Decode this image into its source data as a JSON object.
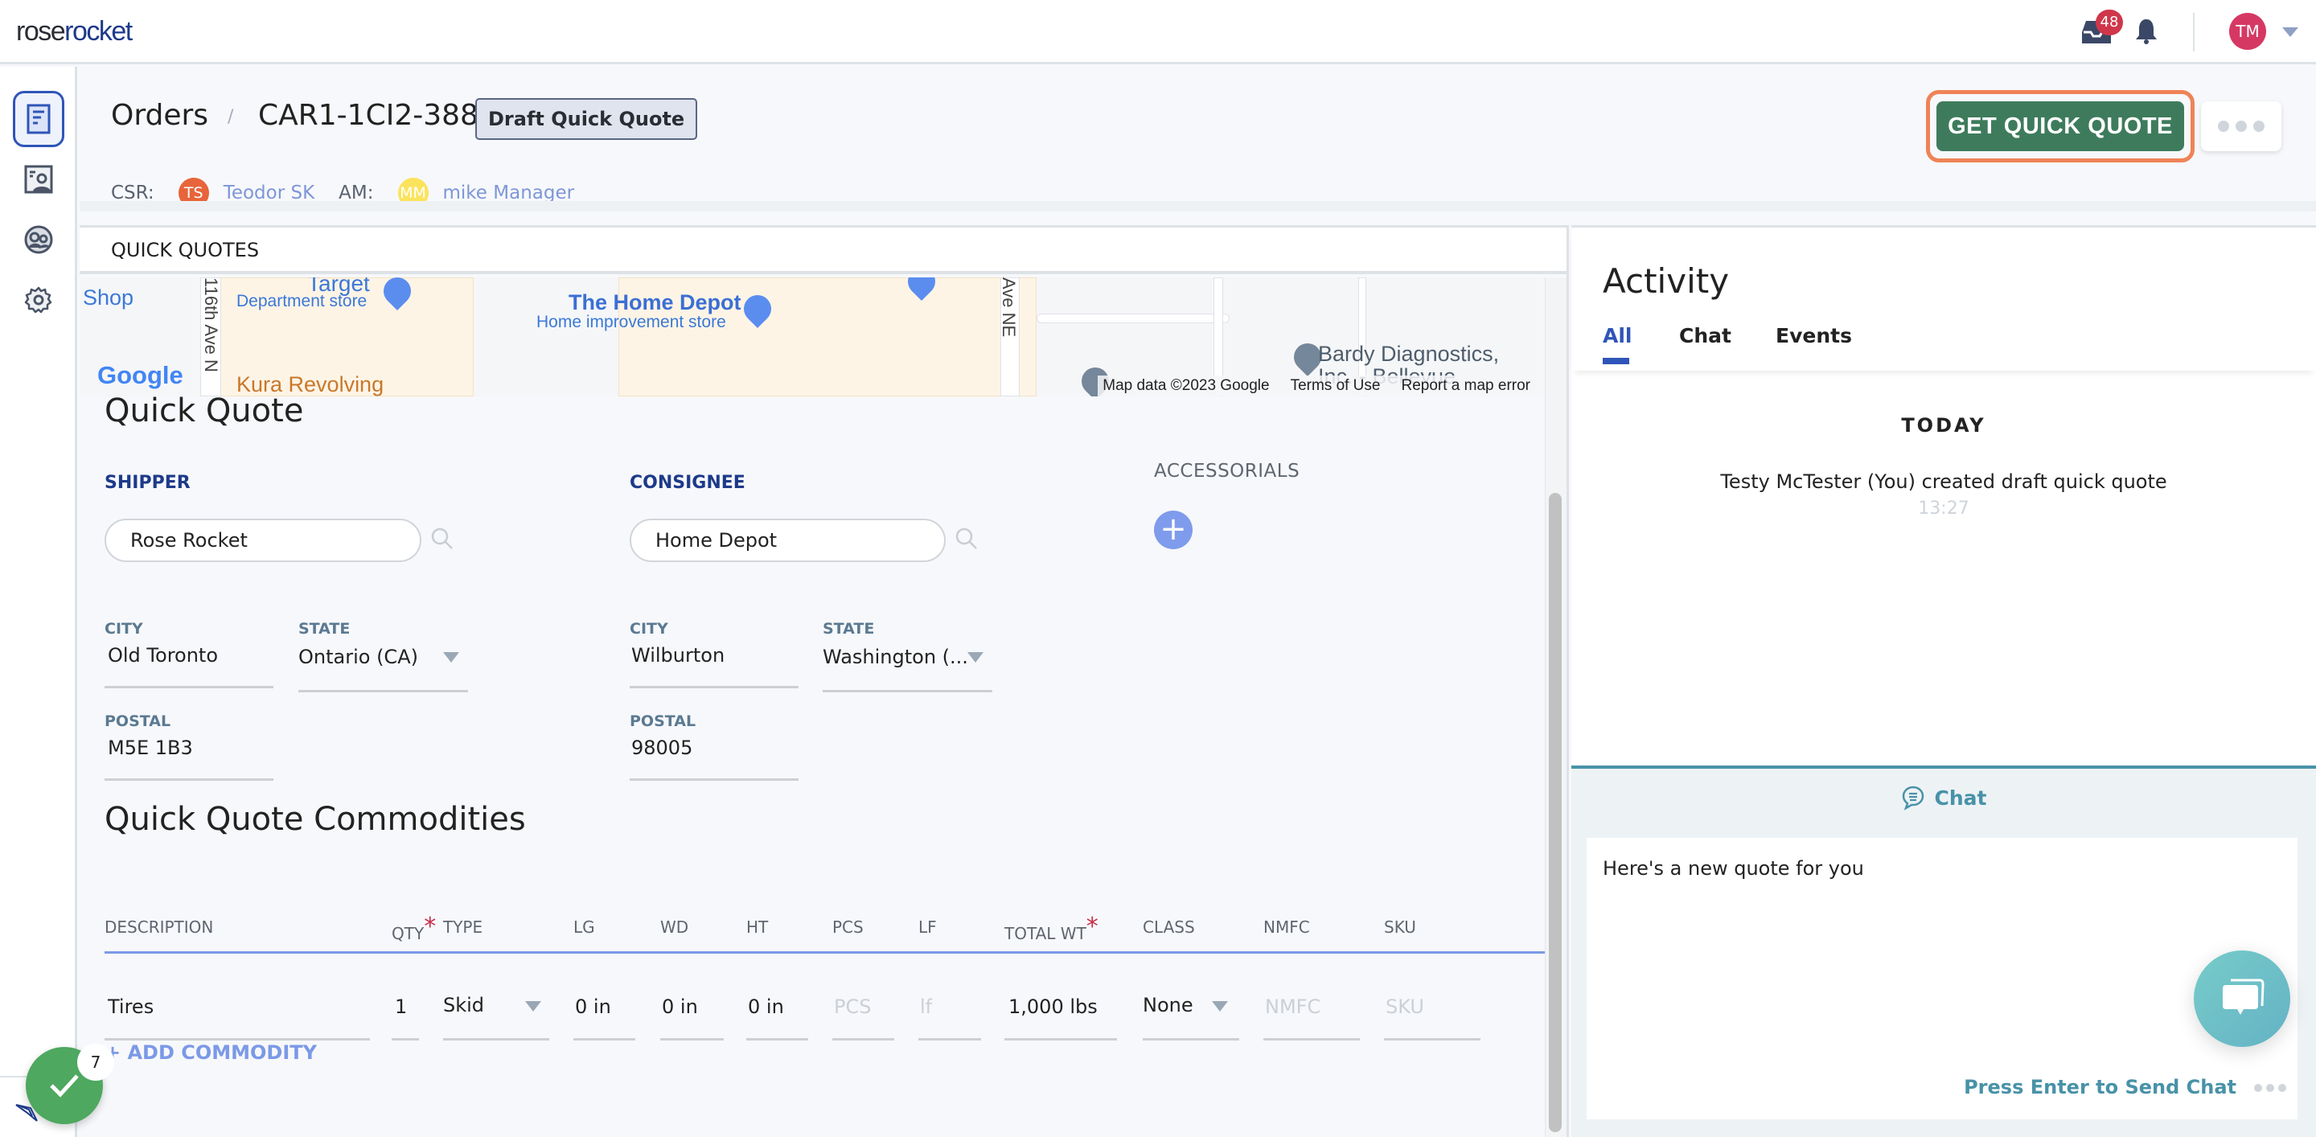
{
  "topbar": {
    "logo_part1": "rose",
    "logo_part2": "rocket",
    "inbox_count": "48",
    "user_initials": "TM"
  },
  "header": {
    "breadcrumb_root": "Orders",
    "breadcrumb_sep": "/",
    "order_id": "CAR1-1CI2-388",
    "status": "Draft Quick Quote",
    "csr_label": "CSR:",
    "csr_initials": "TS",
    "csr_name": "Teodor SK",
    "am_label": "AM:",
    "am_initials": "MM",
    "am_name": "mike Manager",
    "primary_action": "GET QUICK QUOTE"
  },
  "colors": {
    "brand_blue": "#1d3a8a",
    "primary_green": "#3e7b5c",
    "highlight_orange": "#ef8357",
    "link_blue": "#7b99e6",
    "chat_teal": "#4892a8",
    "csr_avatar": "#e8643a",
    "am_avatar": "#fbe35c",
    "user_avatar": "#d63864"
  },
  "main": {
    "tab": "QUICK QUOTES",
    "map": {
      "labels": {
        "shop": "Shop",
        "target": "Target",
        "target_sub": "Department store",
        "home_depot": "The Home Depot",
        "home_depot_sub": "Home improvement store",
        "kura": "Kura Revolving",
        "street1": "116th Ave N",
        "street2": "Ave NE",
        "bardy": "Bardy Diagnostics,",
        "bardy2": "Inc. - Bellevue",
        "google": "Google"
      },
      "footer": [
        "Map data ©2023 Google",
        "Terms of Use",
        "Report a map error"
      ]
    },
    "quick_quote": {
      "title": "Quick Quote",
      "shipper": {
        "label": "SHIPPER",
        "name": "Rose Rocket",
        "city_label": "CITY",
        "city": "Old Toronto",
        "state_label": "STATE",
        "state": "Ontario (CA)",
        "postal_label": "POSTAL",
        "postal": "M5E 1B3"
      },
      "consignee": {
        "label": "CONSIGNEE",
        "name": "Home Depot",
        "city_label": "CITY",
        "city": "Wilburton",
        "state_label": "STATE",
        "state": "Washington (...",
        "postal_label": "POSTAL",
        "postal": "98005"
      },
      "accessorials_label": "ACCESSORIALS"
    },
    "commodities": {
      "title": "Quick Quote Commodities",
      "columns": [
        "DESCRIPTION",
        "QTY",
        "TYPE",
        "LG",
        "WD",
        "HT",
        "PCS",
        "LF",
        "TOTAL WT",
        "CLASS",
        "NMFC",
        "SKU"
      ],
      "required_mark": "*",
      "row": {
        "description": "Tires",
        "qty": "1",
        "type": "Skid",
        "lg": "0 in",
        "wd": "0 in",
        "ht": "0 in",
        "pcs_placeholder": "PCS",
        "lf_placeholder": "lf",
        "total_wt": "1,000 lbs",
        "class": "None",
        "nmfc_placeholder": "NMFC",
        "sku_placeholder": "SKU"
      },
      "add_label": "+ ADD COMMODITY"
    }
  },
  "activity": {
    "title": "Activity",
    "tabs": [
      "All",
      "Chat",
      "Events"
    ],
    "active_tab": "All",
    "day": "TODAY",
    "events": [
      {
        "text": "Testy McTester (You) created draft quick quote",
        "time": "13:27"
      }
    ]
  },
  "chat": {
    "title": "Chat",
    "message": "Here's a new quote for you",
    "hint": "Press Enter to Send Chat"
  },
  "floating": {
    "tasks_count": "7"
  }
}
